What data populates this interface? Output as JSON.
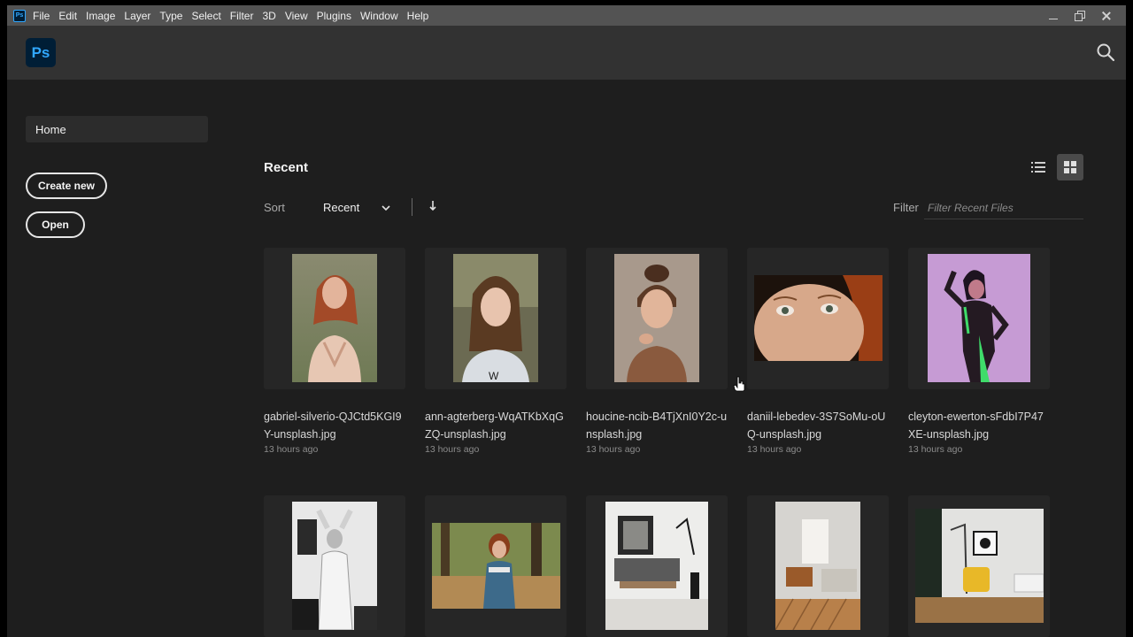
{
  "menubar": {
    "items": [
      "File",
      "Edit",
      "Image",
      "Layer",
      "Type",
      "Select",
      "Filter",
      "3D",
      "View",
      "Plugins",
      "Window",
      "Help"
    ],
    "app_icon_text": "Ps"
  },
  "header": {
    "logo_text": "Ps"
  },
  "sidebar": {
    "home_label": "Home",
    "create_new_label": "Create new",
    "open_label": "Open"
  },
  "recent": {
    "title": "Recent",
    "sort_label": "Sort",
    "sort_value": "Recent",
    "filter_label": "Filter",
    "filter_placeholder": "Filter Recent Files"
  },
  "files": [
    {
      "name": "gabriel-silverio-QJCtd5KGI9Y-unsplash.jpg",
      "time": "13 hours ago"
    },
    {
      "name": "ann-agterberg-WqATKbXqGZQ-unsplash.jpg",
      "time": "13 hours ago"
    },
    {
      "name": "houcine-ncib-B4TjXnI0Y2c-unsplash.jpg",
      "time": "13 hours ago"
    },
    {
      "name": "daniil-lebedev-3S7SoMu-oUQ-unsplash.jpg",
      "time": "13 hours ago"
    },
    {
      "name": "cleyton-ewerton-sFdbI7P47XE-unsplash.jpg",
      "time": "13 hours ago"
    }
  ],
  "colors": {
    "menubar_bg": "#535353",
    "header_bg": "#323232",
    "main_bg": "#1e1e1e",
    "ps_blue": "#31a8ff",
    "ps_navy": "#001e36"
  }
}
